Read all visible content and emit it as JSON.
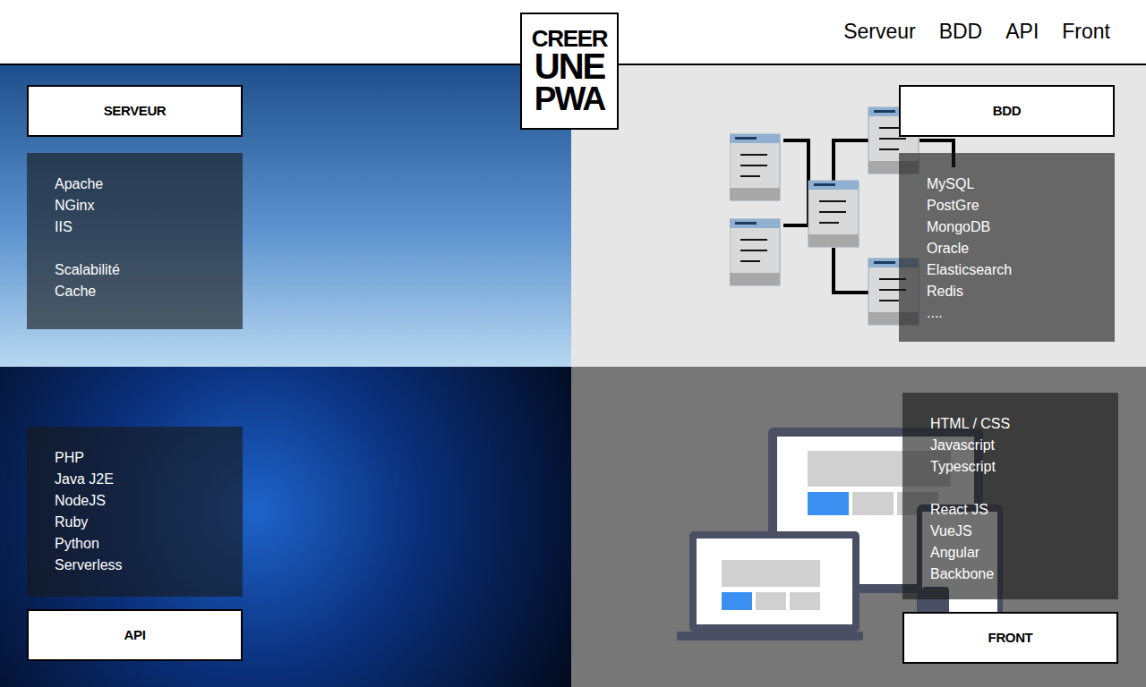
{
  "logo": {
    "lines": [
      "CREER",
      "UNE",
      "PWA"
    ]
  },
  "nav": [
    {
      "label": "Serveur"
    },
    {
      "label": "BDD"
    },
    {
      "label": "API"
    },
    {
      "label": "Front"
    }
  ],
  "sections": [
    {
      "title": "SERVEUR",
      "groups": [
        [
          "Apache",
          "NGinx",
          "IIS"
        ],
        [
          "Scalabilité",
          "Cache"
        ]
      ]
    },
    {
      "title": "BDD",
      "groups": [
        [
          "MySQL",
          "PostGre",
          "MongoDB",
          "Oracle",
          "Elasticsearch",
          "Redis",
          "...."
        ]
      ]
    },
    {
      "title": "API",
      "groups": [
        [
          "PHP",
          "Java J2E",
          "NodeJS",
          "Ruby",
          "Python",
          "Serverless"
        ]
      ]
    },
    {
      "title": "FRONT",
      "groups": [
        [
          "HTML / CSS",
          "Javascript",
          "Typescript"
        ],
        [
          "React JS",
          "VueJS",
          "Angular",
          "Backbone"
        ]
      ]
    }
  ]
}
